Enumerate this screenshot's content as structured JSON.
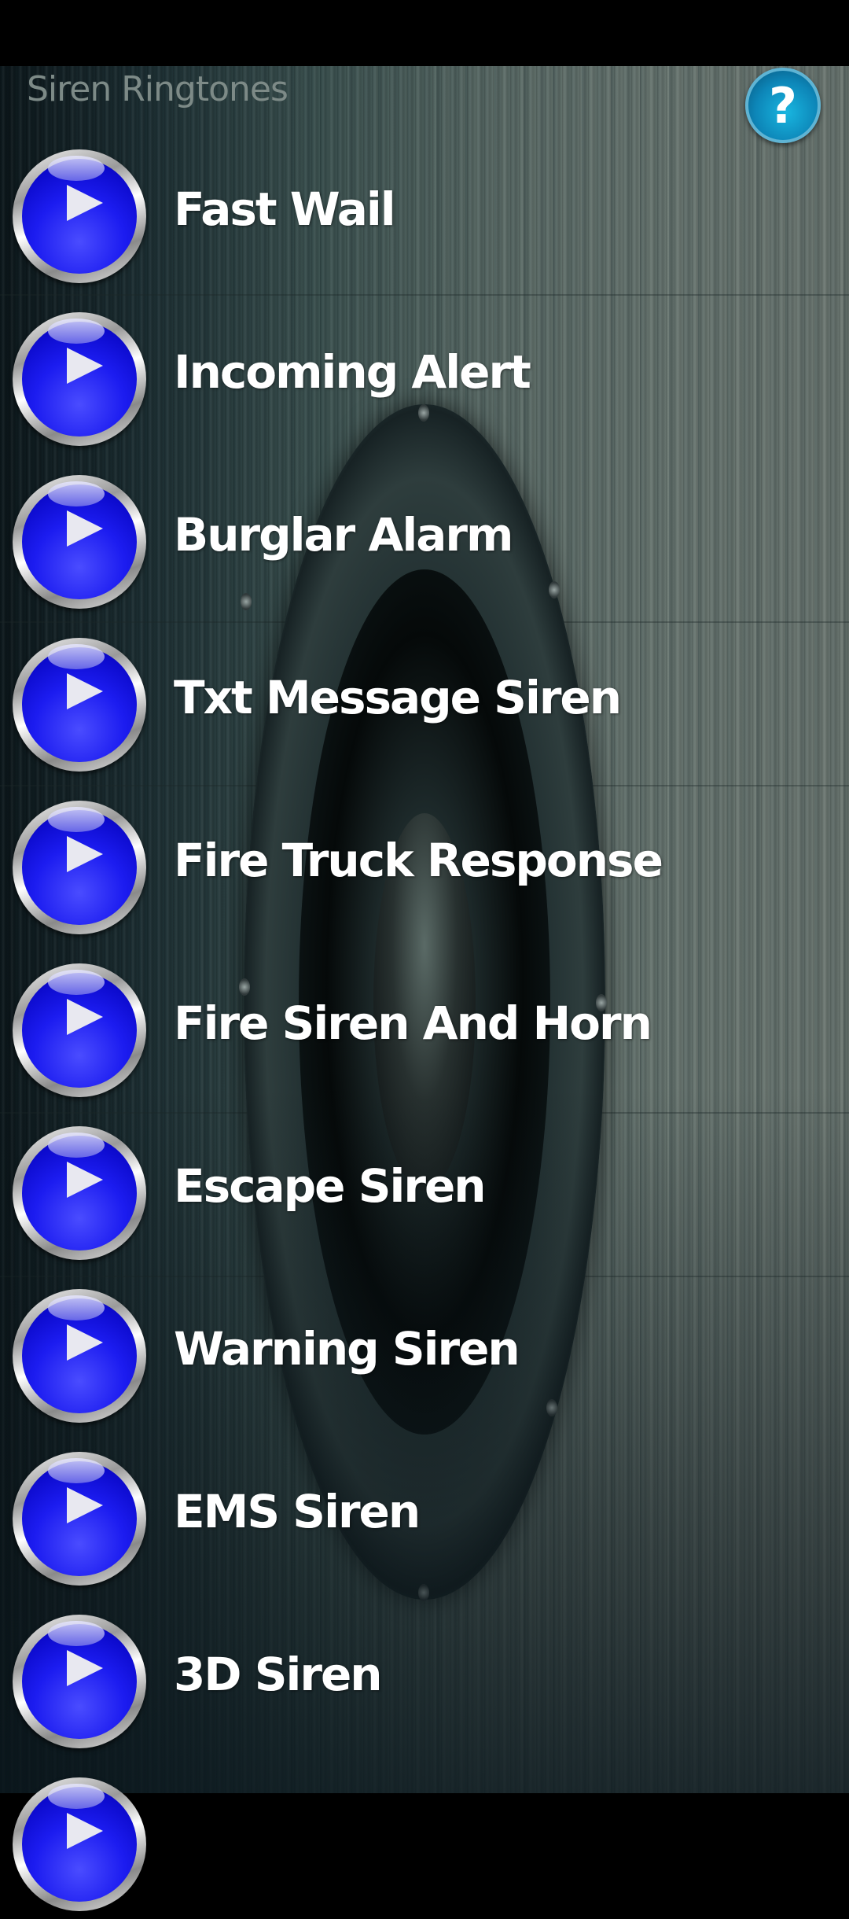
{
  "header": {
    "title": "Siren Ringtones",
    "help_icon": "question-mark-icon",
    "help_glyph": "?"
  },
  "colors": {
    "play_button_blue": "#1c1cf0",
    "help_button_blue": "#0d86b8",
    "title_gray": "#7d8a87",
    "label_white": "#ffffff"
  },
  "ringtones": [
    {
      "label": "Fast Wail",
      "icon": "play-icon"
    },
    {
      "label": "Incoming Alert",
      "icon": "play-icon"
    },
    {
      "label": "Burglar Alarm",
      "icon": "play-icon"
    },
    {
      "label": "Txt Message Siren",
      "icon": "play-icon"
    },
    {
      "label": "Fire Truck Response",
      "icon": "play-icon"
    },
    {
      "label": "Fire Siren And Horn",
      "icon": "play-icon"
    },
    {
      "label": "Escape Siren",
      "icon": "play-icon"
    },
    {
      "label": "Warning Siren",
      "icon": "play-icon"
    },
    {
      "label": "EMS Siren",
      "icon": "play-icon"
    },
    {
      "label": "3D Siren",
      "icon": "play-icon"
    },
    {
      "label": "",
      "icon": "play-icon"
    }
  ]
}
